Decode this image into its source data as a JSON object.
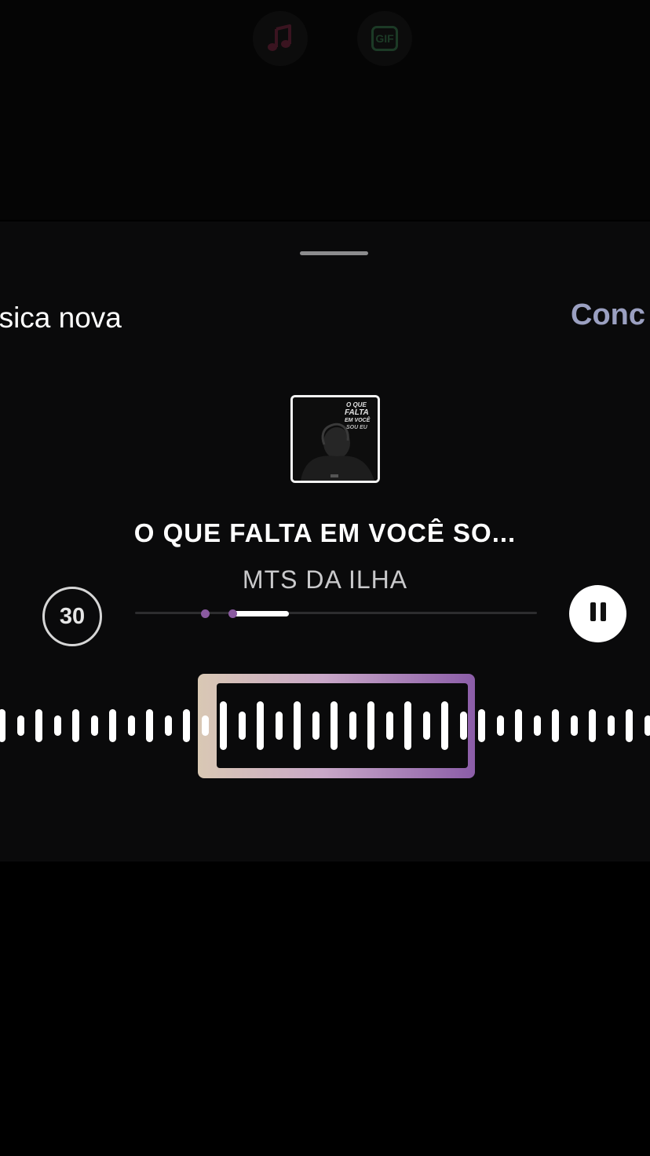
{
  "top_toolbar": {
    "gif_label": "GIF"
  },
  "header": {
    "title": "úsica nova",
    "done_label": "Conc"
  },
  "track": {
    "title": "O QUE FALTA EM VOCÊ SO...",
    "artist": "MTS DA ILHA",
    "duration_seconds": "30",
    "album_art_text": "O QUE FALTA EM VOCÊ SOU EU",
    "selection_progress": 0.25
  },
  "colors": {
    "done_text": "#9ba0c1",
    "accent_purple": "#8b5da8",
    "sheet_bg": "#0a0a0b"
  }
}
